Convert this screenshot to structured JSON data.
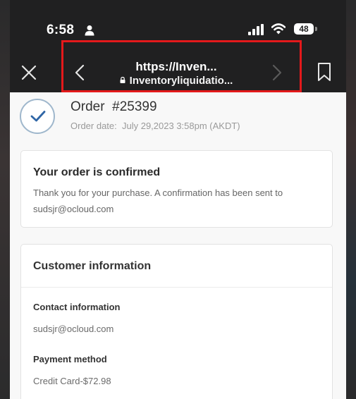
{
  "status_bar": {
    "time": "6:58",
    "battery": "48",
    "icons": [
      "person-icon",
      "signal-icon",
      "wifi-icon",
      "battery-icon"
    ]
  },
  "browser": {
    "url_title": "https://Inven...",
    "url_domain": "Inventoryliquidatio...",
    "icons": [
      "close-icon",
      "back-icon",
      "forward-icon",
      "bookmark-icon",
      "lock-icon"
    ]
  },
  "highlight_color": "#e3191b",
  "order": {
    "title": "Order  #25399",
    "date": "Order date:  July 29,2023 3:58pm (AKDT)"
  },
  "confirmation": {
    "title": "Your order is confirmed",
    "body": "Thank you for your purchase. A confirmation has been sent to sudsjr@ocloud.com"
  },
  "customer": {
    "title": "Customer information",
    "contact_label": "Contact information",
    "contact_value": "sudsjr@ocloud.com",
    "payment_label": "Payment method",
    "payment_value": "Credit Card-$72.98"
  }
}
